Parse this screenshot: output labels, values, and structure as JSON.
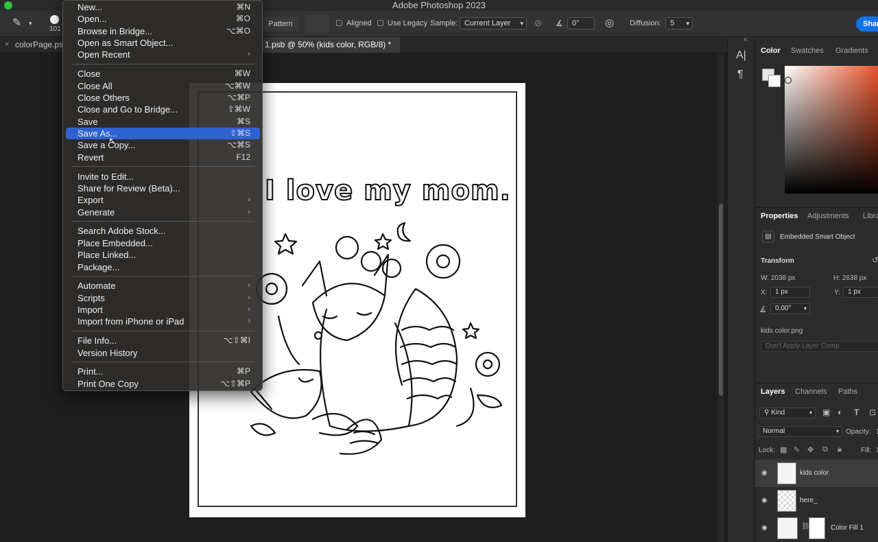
{
  "app": {
    "title": "Adobe Photoshop 2023"
  },
  "options_bar": {
    "size_value": "101",
    "pattern_label": "Pattern",
    "aligned_label": "Aligned",
    "use_legacy_label": "Use Legacy",
    "sample_label": "Sample:",
    "sample_value": "Current Layer",
    "angle_value": "0°",
    "diffusion_label": "Diffusion:",
    "diffusion_value": "5",
    "share_label": "Share"
  },
  "tabs": [
    {
      "label": "colorPage.ps"
    },
    {
      "label": "1.psb @ 50% (kids color, RGB/8) *"
    }
  ],
  "document": {
    "headline": "I love my mom."
  },
  "file_menu": {
    "groups": [
      [
        {
          "label": "New...",
          "shortcut": "⌘N"
        },
        {
          "label": "Open...",
          "shortcut": "⌘O"
        },
        {
          "label": "Browse in Bridge...",
          "shortcut": "⌥⌘O"
        },
        {
          "label": "Open as Smart Object...",
          "shortcut": ""
        },
        {
          "label": "Open Recent",
          "shortcut": "",
          "submenu": true
        }
      ],
      [
        {
          "label": "Close",
          "shortcut": "⌘W"
        },
        {
          "label": "Close All",
          "shortcut": "⌥⌘W"
        },
        {
          "label": "Close Others",
          "shortcut": "⌥⌘P"
        },
        {
          "label": "Close and Go to Bridge...",
          "shortcut": "⇧⌘W"
        },
        {
          "label": "Save",
          "shortcut": "⌘S"
        },
        {
          "label": "Save As...",
          "shortcut": "⇧⌘S",
          "highlighted": true
        },
        {
          "label": "Save a Copy...",
          "shortcut": "⌥⌘S"
        },
        {
          "label": "Revert",
          "shortcut": "F12"
        }
      ],
      [
        {
          "label": "Invite to Edit...",
          "shortcut": ""
        },
        {
          "label": "Share for Review (Beta)...",
          "shortcut": ""
        },
        {
          "label": "Export",
          "shortcut": "",
          "submenu": true
        },
        {
          "label": "Generate",
          "shortcut": "",
          "submenu": true
        }
      ],
      [
        {
          "label": "Search Adobe Stock...",
          "shortcut": ""
        },
        {
          "label": "Place Embedded...",
          "shortcut": ""
        },
        {
          "label": "Place Linked...",
          "shortcut": ""
        },
        {
          "label": "Package...",
          "shortcut": ""
        }
      ],
      [
        {
          "label": "Automate",
          "shortcut": "",
          "submenu": true
        },
        {
          "label": "Scripts",
          "shortcut": "",
          "submenu": true
        },
        {
          "label": "Import",
          "shortcut": "",
          "submenu": true
        },
        {
          "label": "Import from iPhone or iPad",
          "shortcut": "",
          "submenu": true
        }
      ],
      [
        {
          "label": "File Info...",
          "shortcut": "⌥⇧⌘I"
        },
        {
          "label": "Version History",
          "shortcut": ""
        }
      ],
      [
        {
          "label": "Print...",
          "shortcut": "⌘P"
        },
        {
          "label": "Print One Copy",
          "shortcut": "⌥⇧⌘P"
        }
      ]
    ]
  },
  "color_panel": {
    "tabs": [
      "Color",
      "Swatches",
      "Gradients"
    ]
  },
  "properties_panel": {
    "tabs": [
      "Properties",
      "Adjustments",
      "Libra"
    ],
    "object_type": "Embedded Smart Object",
    "transform_label": "Transform",
    "w": "W: 2038 px",
    "h": "H: 2638 px",
    "x_label": "X:",
    "x_value": "1 px",
    "y_label": "Y:",
    "y_value": "1 px",
    "angle": "0,00°",
    "file": "kids color.png",
    "layer_comp": "Don't Apply Layer Comp"
  },
  "layers_panel": {
    "tabs": [
      "Layers",
      "Channels",
      "Paths"
    ],
    "filter": "Kind",
    "blend_mode": "Normal",
    "opacity_label": "Opacity:",
    "opacity_value": "1",
    "lock_label": "Lock:",
    "fill_label": "Fill:",
    "fill_value": "1",
    "layers": [
      {
        "name": "kids color",
        "selected": true
      },
      {
        "name": "here_",
        "selected": false
      },
      {
        "name": "Color Fill 1",
        "selected": false
      }
    ]
  }
}
